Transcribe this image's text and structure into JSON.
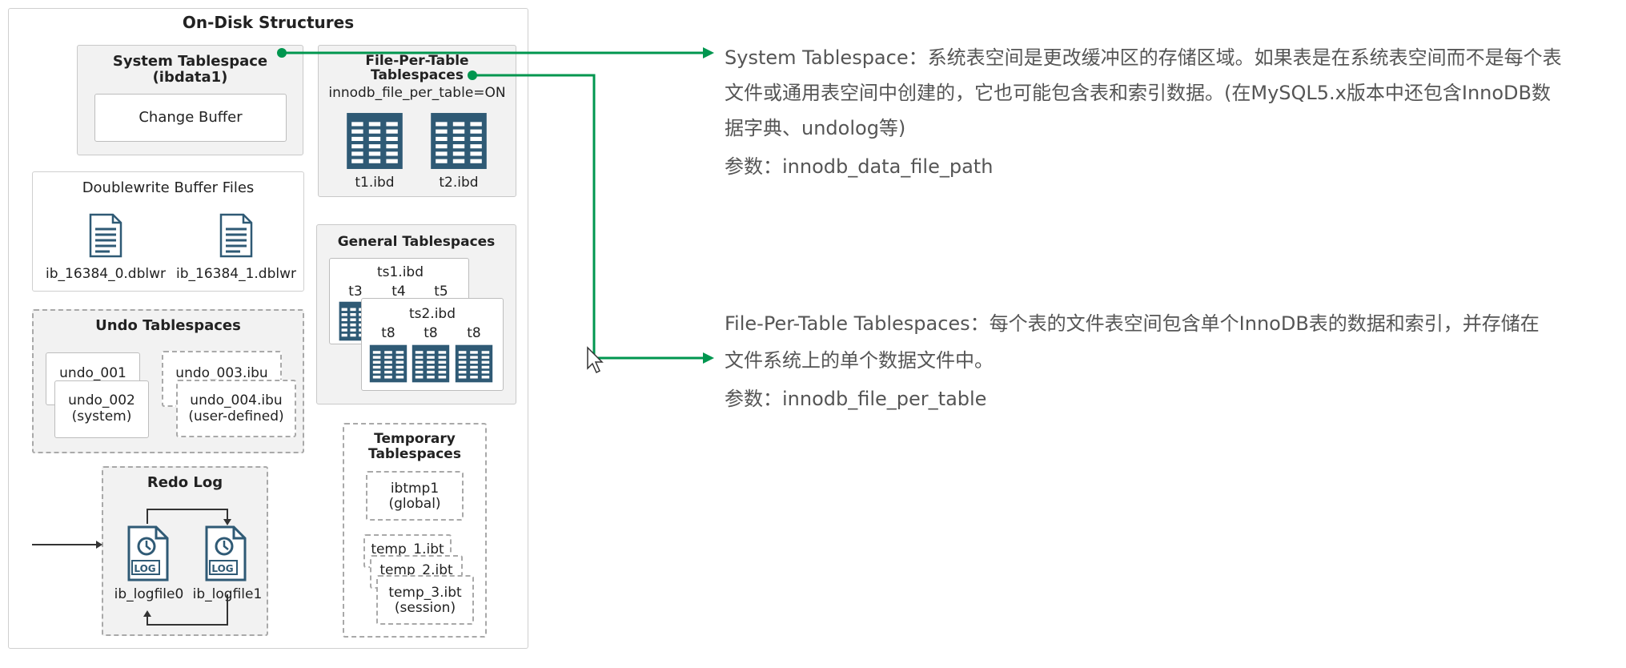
{
  "diagram": {
    "title": "On-Disk Structures",
    "system_tablespace": {
      "title": "System Tablespace",
      "file": "(ibdata1)",
      "change_buffer": "Change Buffer"
    },
    "file_per_table": {
      "title_line1": "File-Per-Table",
      "title_line2": "Tablespaces",
      "setting": "innodb_file_per_table=ON",
      "files": [
        "t1.ibd",
        "t2.ibd"
      ]
    },
    "doublewrite": {
      "title": "Doublewrite Buffer Files",
      "files": [
        "ib_16384_0.dblwr",
        "ib_16384_1.dblwr"
      ]
    },
    "general_tablespaces": {
      "title": "General Tablespaces",
      "ts1": {
        "name": "ts1.ibd",
        "tables": [
          "t3",
          "t4",
          "t5"
        ]
      },
      "ts2": {
        "name": "ts2.ibd",
        "tables": [
          "t8",
          "t8",
          "t8"
        ]
      }
    },
    "undo_tablespaces": {
      "title": "Undo Tablespaces",
      "undo_001": "undo_001",
      "undo_002": "undo_002",
      "undo_002_sub": "(system)",
      "undo_003": "undo_003.ibu",
      "undo_004": "undo_004.ibu",
      "undo_004_sub": "(user-defined)"
    },
    "temporary_tablespaces": {
      "title_line1": "Temporary",
      "title_line2": "Tablespaces",
      "ibtmp1": "ibtmp1",
      "ibtmp1_sub": "(global)",
      "temp_1": "temp_1.ibt",
      "temp_2": "temp_2.ibt",
      "temp_3": "temp_3.ibt",
      "temp_3_sub": "(session)"
    },
    "redo_log": {
      "title": "Redo Log",
      "files": [
        "ib_logfile0",
        "ib_logfile1"
      ],
      "icon_text": "LOG"
    }
  },
  "notes": {
    "system_tablespace": {
      "lines": [
        "System Tablespace：系统表空间是更改缓冲区的存储区域。如果表是在系统表空间而不是每个表",
        "文件或通用表空间中创建的，它也可能包含表和索引数据。(在MySQL5.x版本中还包含InnoDB数",
        "据字典、undolog等)"
      ],
      "param": "参数：innodb_data_file_path"
    },
    "file_per_table": {
      "lines": [
        "File-Per-Table Tablespaces：每个表的文件表空间包含单个InnoDB表的数据和索引，并存储在",
        "文件系统上的单个数据文件中。"
      ],
      "param": "参数：innodb_file_per_table"
    }
  },
  "colors": {
    "accent_green": "#00964f",
    "table_icon": "#2f5a75",
    "box_fill": "#f2f2f2"
  }
}
